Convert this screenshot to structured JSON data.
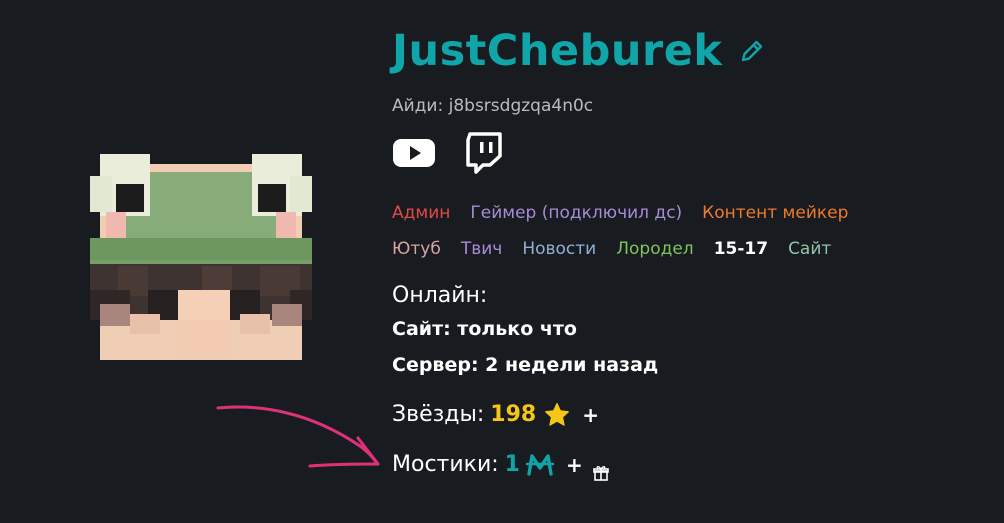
{
  "profile": {
    "username": "JustCheburek",
    "id_label": "Айди:",
    "id_value": "j8bsrsdgzqa4n0c"
  },
  "socials": [
    {
      "name": "youtube-icon"
    },
    {
      "name": "twitch-icon"
    }
  ],
  "tags": {
    "row1": [
      "Админ",
      "Геймер (подключил дс)",
      "Контент мейкер"
    ],
    "row2": [
      "Ютуб",
      "Твич",
      "Новости",
      "Лородел",
      "15-17",
      "Сайт"
    ]
  },
  "online": {
    "title": "Онлайн:",
    "site": "Сайт: только что",
    "server": "Сервер: 2 недели назад"
  },
  "stars": {
    "label": "Звёзды:",
    "value": "198",
    "add": "+"
  },
  "bridges": {
    "label": "Мостики:",
    "value": "1",
    "add": "+"
  },
  "colors": {
    "background": "#181b1f",
    "accent": "#10a5a8",
    "star": "#f5c518",
    "arrow": "#e0307a"
  }
}
